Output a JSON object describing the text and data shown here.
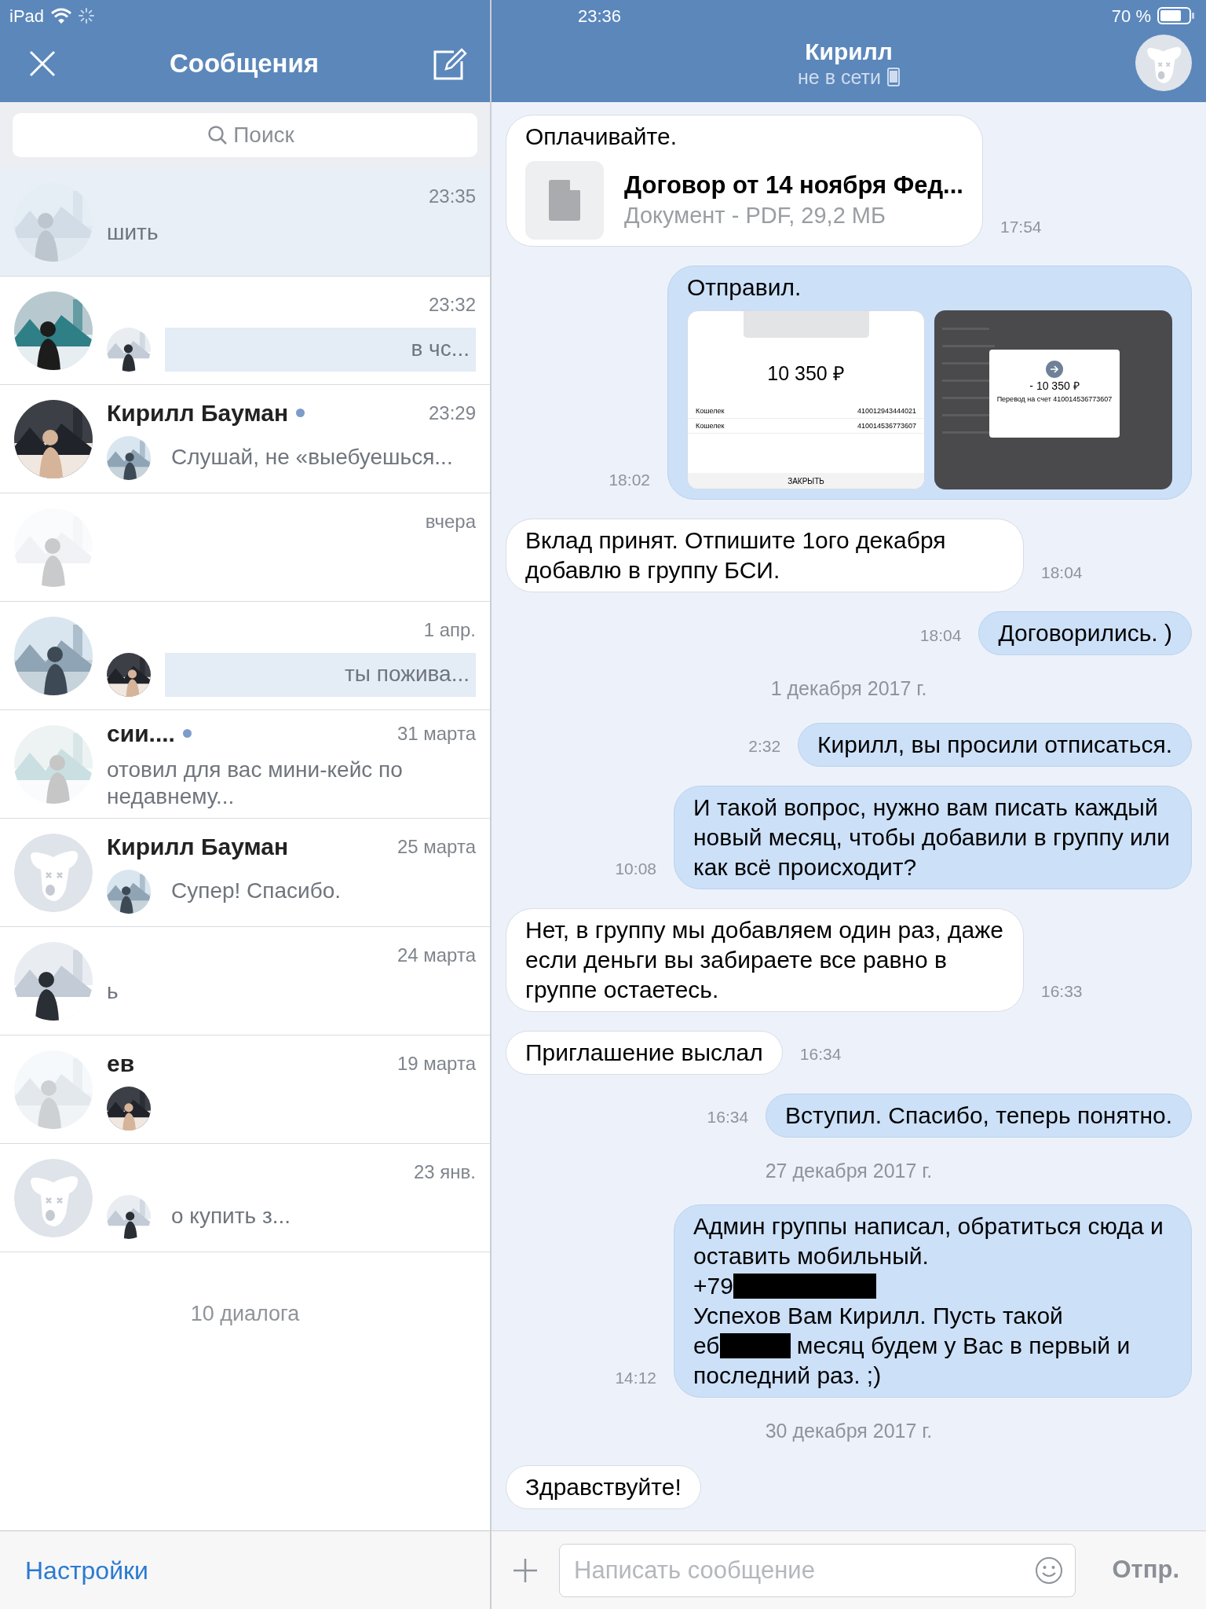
{
  "status_bar": {
    "device": "iPad",
    "time": "23:36",
    "battery": "70 %"
  },
  "sidebar": {
    "title": "Сообщения",
    "search": {
      "placeholder": "Поиск"
    },
    "dialogs": [
      {
        "time": "23:35",
        "preview": "шить",
        "avatar": {
          "kind": "erased"
        },
        "sender_avatar": false,
        "selected": true,
        "unread": false,
        "online": false
      },
      {
        "time": "23:32",
        "preview": "в чс...",
        "sender_avatar": true,
        "selected": false,
        "unread": true,
        "online": false
      },
      {
        "name": "Кирилл Бауман",
        "time": "23:29",
        "preview": "Слушай, не «выебуешься...",
        "sender_avatar": true,
        "selected": false,
        "unread": false,
        "online": true
      },
      {
        "time": "вчера",
        "avatar": {
          "kind": "erased"
        },
        "sender_avatar": false,
        "selected": false,
        "unread": false,
        "online": false
      },
      {
        "time": "1 апр.",
        "preview": "ты пожива...",
        "sender_avatar": true,
        "selected": false,
        "unread": true,
        "online": false
      },
      {
        "name": "сии....",
        "time": "31 марта",
        "preview": "отовил для вас мини-кейс по недавнему...",
        "avatar": {
          "kind": "erased"
        },
        "sender_avatar": false,
        "selected": false,
        "unread": false,
        "online": true
      },
      {
        "name": "Кирилл Бауман",
        "time": "25 марта",
        "preview": "Супер! Спасибо.",
        "avatar": {
          "kind": "default"
        },
        "sender_avatar": true,
        "selected": false,
        "unread": false,
        "online": false
      },
      {
        "time": "24 марта",
        "preview": "ь",
        "sender_avatar": false,
        "selected": false,
        "unread": false,
        "online": false
      },
      {
        "name": "ев",
        "time": "19 марта",
        "avatar": {
          "kind": "erased"
        },
        "sender_avatar": true,
        "selected": false,
        "unread": false,
        "online": false
      },
      {
        "time": "23 янв.",
        "preview": "о купить з...",
        "avatar": {
          "kind": "default"
        },
        "sender_avatar": true,
        "selected": false,
        "unread": false,
        "online": false
      }
    ],
    "count": "10 диалога",
    "settings": "Настройки"
  },
  "chat": {
    "title": "Кирилл",
    "subtitle": "не в сети",
    "messages": [
      {
        "kind": "in",
        "text": "Оплачивайте.",
        "time": "17:54",
        "attachment": {
          "title": "Договор от 14 ноября Фед...",
          "meta": "Документ - PDF, 29,2 МБ"
        }
      },
      {
        "kind": "out",
        "text": "Отправил.",
        "time": "18:02",
        "images": [
          {
            "kind": "light",
            "amount": "10 350 ₽",
            "rows": [
              {
                "label": "Кошелек",
                "value": "410012943444021"
              },
              {
                "label": "Кошелек",
                "value": "410014536773607"
              }
            ],
            "button": "ЗАКРЫТЬ"
          },
          {
            "kind": "dark",
            "amount": "- 10 350 ₽",
            "caption": "Перевод на счет 410014536773607"
          }
        ]
      },
      {
        "kind": "in",
        "text": "Вклад принят. Отпишите 1ого декабря добавлю в группу БСИ.",
        "time": "18:04"
      },
      {
        "kind": "out",
        "text": "Договорились. )",
        "time": "18:04"
      },
      {
        "kind": "date",
        "text": "1 декабря 2017 г."
      },
      {
        "kind": "out",
        "text": "Кирилл, вы просили отписаться.",
        "time": "2:32"
      },
      {
        "kind": "out",
        "text": "И такой вопрос, нужно вам писать каждый новый месяц, чтобы добавили в группу или как всё происходит?",
        "time": "10:08"
      },
      {
        "kind": "in",
        "text": "Нет, в группу мы добавляем один раз, даже если деньги вы забираете все равно в группе остаетесь.",
        "time": "16:33"
      },
      {
        "kind": "in",
        "text": "Приглашение выслал",
        "time": "16:34"
      },
      {
        "kind": "out",
        "text": "Вступил. Спасибо, теперь понятно.",
        "time": "16:34"
      },
      {
        "kind": "date",
        "text": "27 декабря 2017 г."
      },
      {
        "kind": "out",
        "time": "14:12",
        "parts": [
          {
            "kind": "text",
            "text": "Админ группы написал, обратиться сюда и оставить мобильный.\n+79"
          },
          {
            "kind": "redacted_long"
          },
          {
            "kind": "text",
            "text": "\nУспехов Вам Кирилл. Пусть такой\nеб"
          },
          {
            "kind": "redacted_short"
          },
          {
            "kind": "text",
            "text": " месяц будем у Вас в первый и последний раз. ;)"
          }
        ]
      },
      {
        "kind": "date",
        "text": "30 декабря 2017 г."
      },
      {
        "kind": "in",
        "text": "Здравствуйте!"
      }
    ],
    "input": {
      "placeholder": "Написать сообщение"
    },
    "send": "Отпр."
  }
}
